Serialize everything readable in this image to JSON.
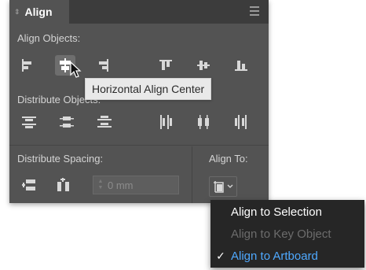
{
  "panel": {
    "tab_title": "Align",
    "tab_grip": "⇕",
    "menu_icon": "hamburger-icon"
  },
  "align_objects": {
    "label": "Align Objects:",
    "buttons": [
      {
        "name": "horizontal-align-left",
        "icon": "align-left-icon"
      },
      {
        "name": "horizontal-align-center",
        "icon": "align-center-icon",
        "active": true
      },
      {
        "name": "horizontal-align-right",
        "icon": "align-right-icon"
      },
      {
        "name": "vertical-align-top",
        "icon": "align-top-icon"
      },
      {
        "name": "vertical-align-center",
        "icon": "align-middle-icon"
      },
      {
        "name": "vertical-align-bottom",
        "icon": "align-bottom-icon"
      }
    ]
  },
  "tooltip": {
    "text": "Horizontal Align Center"
  },
  "distribute_objects": {
    "label": "Distribute Objects:",
    "buttons": [
      {
        "name": "vertical-distribute-top",
        "icon": "distribute-top-icon"
      },
      {
        "name": "vertical-distribute-center",
        "icon": "distribute-vcenter-icon"
      },
      {
        "name": "vertical-distribute-bottom",
        "icon": "distribute-bottom-icon"
      },
      {
        "name": "horizontal-distribute-left",
        "icon": "distribute-left-icon"
      },
      {
        "name": "horizontal-distribute-center",
        "icon": "distribute-hcenter-icon"
      },
      {
        "name": "horizontal-distribute-right",
        "icon": "distribute-right-icon"
      }
    ]
  },
  "distribute_spacing": {
    "label": "Distribute Spacing:",
    "input_placeholder": "0 mm"
  },
  "align_to": {
    "label": "Align To:",
    "icon": "artboard-icon"
  },
  "dropdown": {
    "items": [
      {
        "label": "Align to Selection",
        "state": "normal"
      },
      {
        "label": "Align to Key Object",
        "state": "disabled"
      },
      {
        "label": "Align to Artboard",
        "state": "selected",
        "check": "✓"
      }
    ]
  },
  "colors": {
    "panel_bg": "#535353",
    "header_bg": "#3c3c3c",
    "icon": "#d8d8d8",
    "selected_blue": "#4fa9ff",
    "dropdown_bg": "#262626"
  }
}
